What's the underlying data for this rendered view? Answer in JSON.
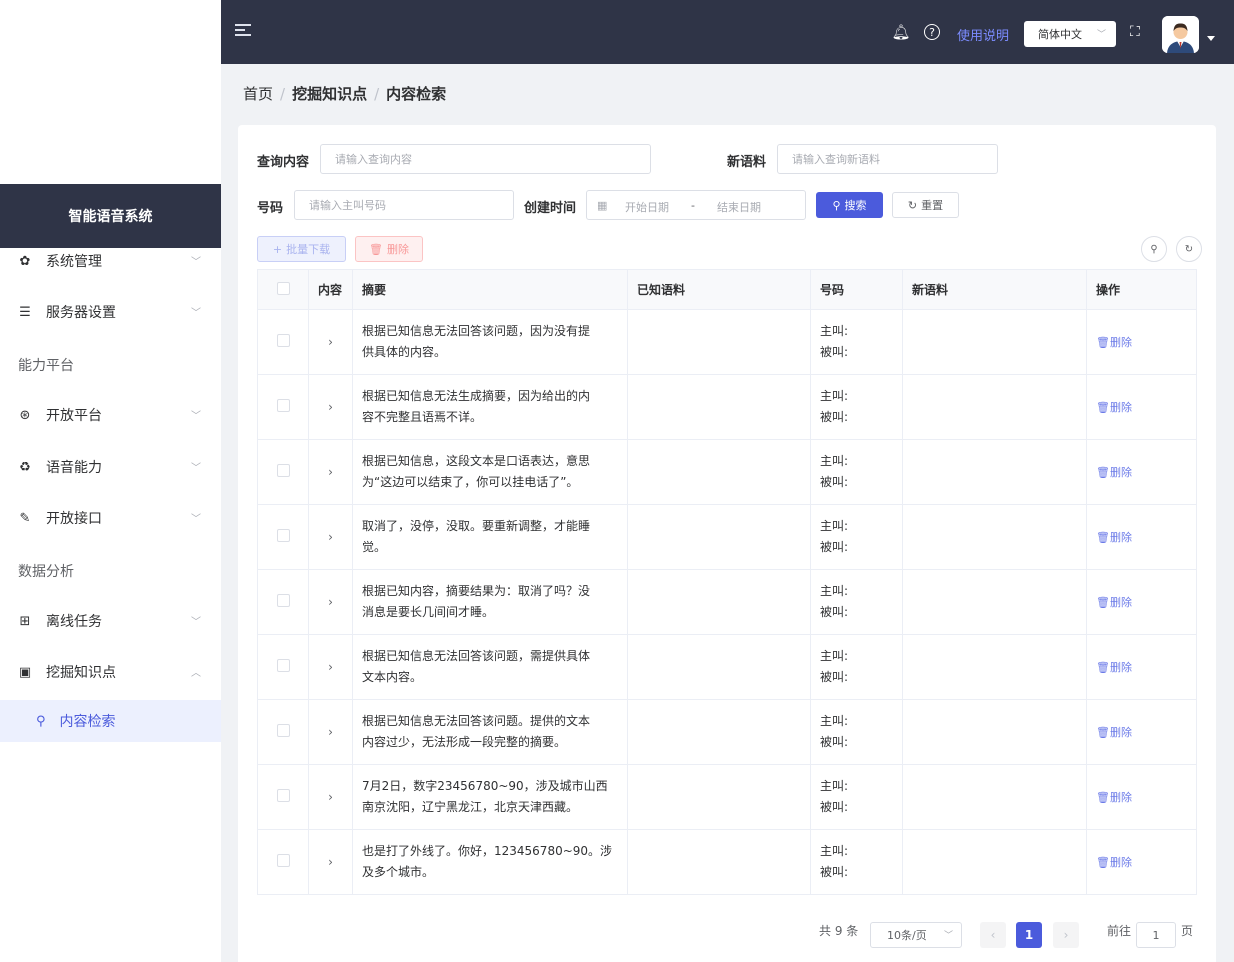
{
  "app": {
    "name": "智能语音系统"
  },
  "sidebar": {
    "items": [
      {
        "label": "系统管理",
        "icon": "gear-icon"
      },
      {
        "label": "服务器设置",
        "icon": "server-icon"
      },
      {
        "label": "开放平台",
        "icon": "platform-icon"
      },
      {
        "label": "语音能力",
        "icon": "voice-icon"
      },
      {
        "label": "开放接口",
        "icon": "api-icon"
      },
      {
        "label": "离线任务",
        "icon": "table-icon"
      },
      {
        "label": "挖掘知识点",
        "icon": "knowledge-icon"
      }
    ],
    "groups": [
      "能力平台",
      "数据分析"
    ],
    "active_sub": "内容检索"
  },
  "topbar": {
    "usage_label": "使用说明",
    "language": "简体中文"
  },
  "breadcrumb": [
    "首页",
    "挖掘知识点",
    "内容检索"
  ],
  "filters": {
    "query_label": "查询内容",
    "query_placeholder": "请输入查询内容",
    "new_corpus_label": "新语料",
    "new_corpus_placeholder": "请输入查询新语料",
    "number_label": "号码",
    "number_placeholder": "请输入主叫号码",
    "created_label": "创建时间",
    "start_date_placeholder": "开始日期",
    "date_sep": "-",
    "end_date_placeholder": "结束日期",
    "search_button": "搜索",
    "reset_button": "重置"
  },
  "toolbar": {
    "batch_download": "批量下载",
    "delete": "删除"
  },
  "table": {
    "columns": [
      "内容",
      "摘要",
      "已知语料",
      "号码",
      "新语料",
      "操作"
    ],
    "caller_label": "主叫:",
    "callee_label": "被叫:",
    "delete_label": "删除",
    "rows": [
      {
        "summary_1": "根据已知信息无法回答该问题，因为没有提",
        "summary_2": "供具体的内容。"
      },
      {
        "summary_1": "根据已知信息无法生成摘要，因为给出的内",
        "summary_2": "容不完整且语焉不详。"
      },
      {
        "summary_1": "根据已知信息，这段文本是口语表达，意思",
        "summary_2": "为“这边可以结束了，你可以挂电话了”。"
      },
      {
        "summary_1": "取消了，没停，没取。要重新调整，才能睡",
        "summary_2": "觉。"
      },
      {
        "summary_1": "根据已知内容，摘要结果为：取消了吗？没",
        "summary_2": "消息是要长几间间才睡。"
      },
      {
        "summary_1": "根据已知信息无法回答该问题，需提供具体",
        "summary_2": "文本内容。"
      },
      {
        "summary_1": "根据已知信息无法回答该问题。提供的文本",
        "summary_2": "内容过少，无法形成一段完整的摘要。"
      },
      {
        "summary_1": "7月2日，数字23456780~90，涉及城市山西",
        "summary_2": "南京沈阳，辽宁黑龙江，北京天津西藏。"
      },
      {
        "summary_1": "也是打了外线了。你好，123456780~90。涉",
        "summary_2": "及多个城市。"
      }
    ]
  },
  "pagination": {
    "total": "共 9 条",
    "page_size": "10条/页",
    "current_page": "1",
    "goto_label": "前往",
    "goto_value": "1",
    "page_suffix": "页"
  },
  "colors": {
    "primary": "#4b5bdc",
    "header": "#2f3447",
    "danger": "#f56c6c"
  }
}
